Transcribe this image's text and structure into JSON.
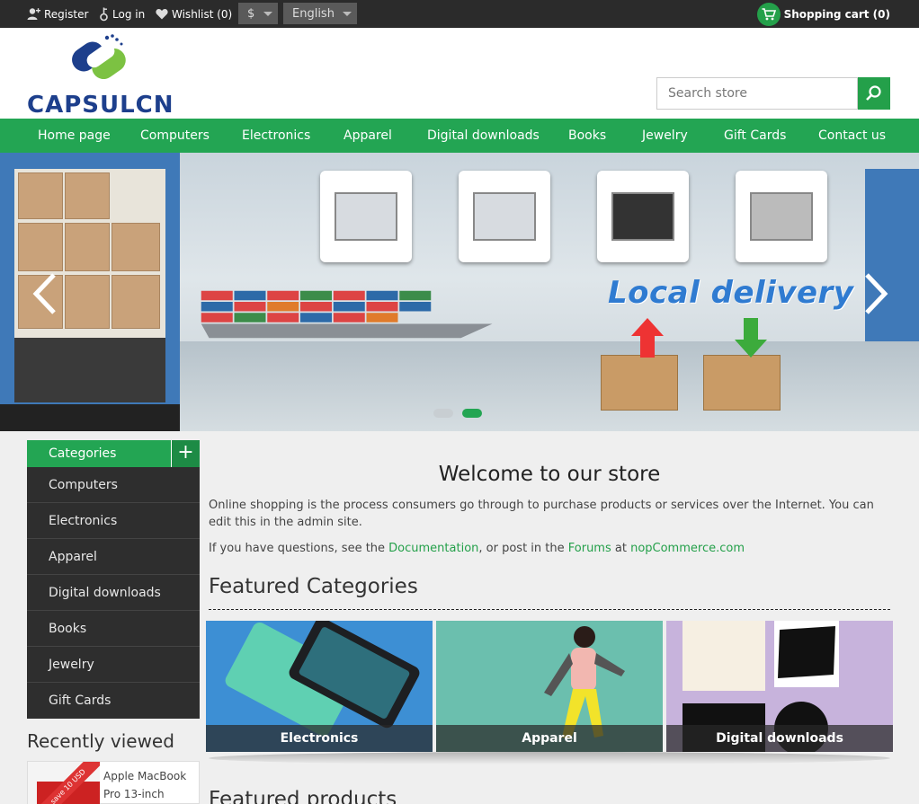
{
  "topbar": {
    "register": "Register",
    "login": "Log in",
    "wishlist": "Wishlist (0)",
    "currency": "$",
    "language": "English",
    "cart": "Shopping cart (0)"
  },
  "header": {
    "logo_text": "CAPSULCN",
    "search_placeholder": "Search store"
  },
  "nav": {
    "items": [
      "Home page",
      "Computers",
      "Electronics",
      "Apparel",
      "Digital downloads",
      "Books",
      "Jewelry",
      "Gift Cards",
      "Contact us"
    ]
  },
  "banner": {
    "caption": "Local delivery",
    "slides": 2,
    "active_slide": 2
  },
  "sidebar": {
    "categories_title": "Categories",
    "categories": [
      "Computers",
      "Electronics",
      "Apparel",
      "Digital downloads",
      "Books",
      "Jewelry",
      "Gift Cards"
    ],
    "recently_viewed_title": "Recently viewed",
    "recent_product": "Apple MacBook Pro 13-inch",
    "recent_ribbon": "save 10 USD"
  },
  "main": {
    "welcome_title": "Welcome to our store",
    "intro": "Online shopping is the process consumers go through to purchase products or services over the Internet. You can edit this in the admin site.",
    "questions_prefix": "If you have questions, see the ",
    "documentation_link": "Documentation",
    "questions_mid": ", or post in the ",
    "forums_link": "Forums",
    "questions_at": " at ",
    "site_link": "nopCommerce.com",
    "featured_categories_title": "Featured Categories",
    "featured_categories": [
      "Electronics",
      "Apparel",
      "Digital downloads"
    ],
    "featured_products_title": "Featured products"
  },
  "colors": {
    "brand_green": "#23a553",
    "topbar": "#2b2b2b",
    "sidebar": "#2e2e2e"
  }
}
